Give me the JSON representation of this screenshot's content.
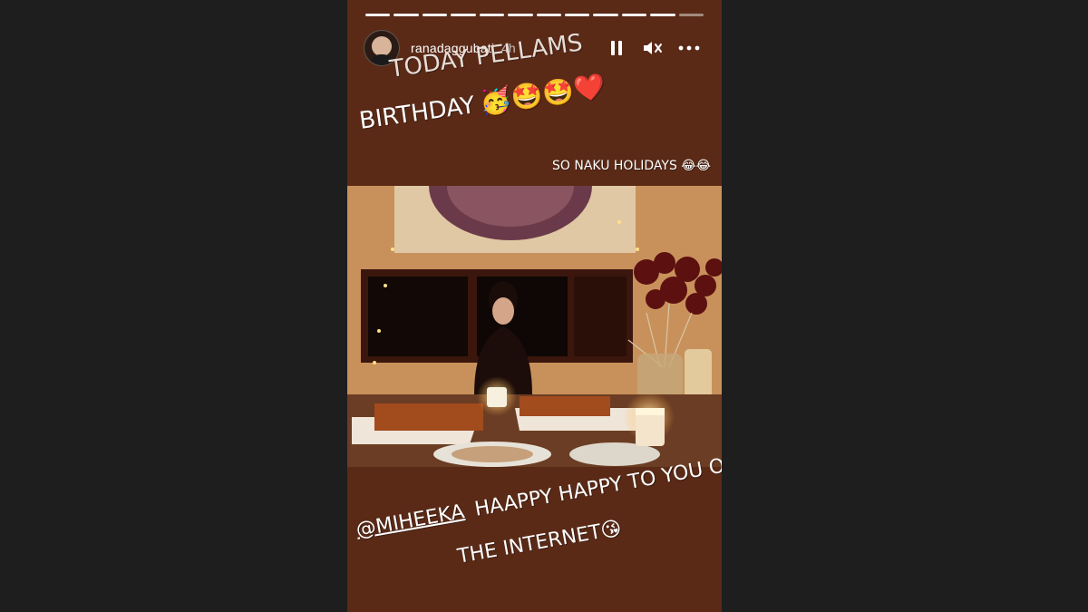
{
  "story": {
    "progress_total": 12,
    "progress_current": 12,
    "username": "ranadaggubati",
    "time_ago": "4h",
    "controls": {
      "pause_icon": "pause-icon",
      "mute_icon": "speaker-muted-icon",
      "more_icon": "more-horizontal-icon"
    },
    "text": {
      "line1": "TODAY PELLAMS",
      "line2": "BIRTHDAY",
      "line2_emojis": "🥳🤩🤩❤️",
      "line3": "SO NAKU HOLIDAYS 😂😂",
      "mention": "@MIHEEKA",
      "line4": "HAAPPY HAPPY TO YOU ON",
      "line5": "THE INTERNET😘"
    }
  }
}
